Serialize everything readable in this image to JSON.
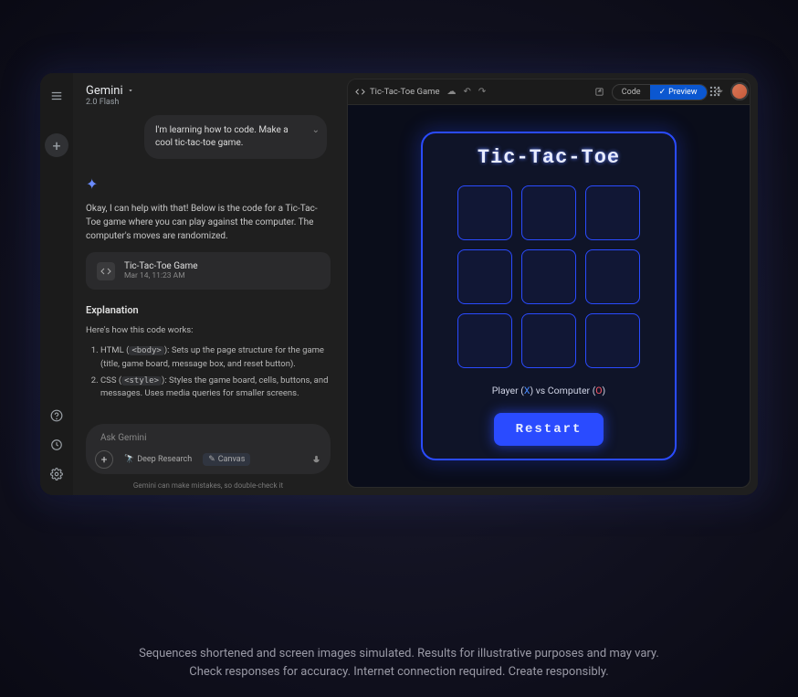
{
  "header": {
    "app_name": "Gemini",
    "model": "2.0 Flash"
  },
  "conversation": {
    "user_prompt": "I'm learning how to code. Make a cool tic-tac-toe game.",
    "assistant_intro": "Okay, I can help with that! Below is the code for a Tic-Tac-Toe game where you can play against the computer. The computer's moves are randomized.",
    "artifact": {
      "title": "Tic-Tac-Toe Game",
      "timestamp": "Mar 14, 11:23 AM"
    },
    "explanation_title": "Explanation",
    "explanation_intro": "Here's how this code works:",
    "explanation_items": [
      {
        "prefix": "HTML (",
        "code": "<body>",
        "suffix": "): Sets up the page structure for the game (title, game board, message box, and reset button)."
      },
      {
        "prefix": "CSS (",
        "code": "<style>",
        "suffix": "): Styles the game board, cells, buttons, and messages. Uses media queries for smaller screens."
      }
    ]
  },
  "composer": {
    "placeholder": "Ask Gemini",
    "chip_deep_research": "Deep Research",
    "chip_canvas": "Canvas"
  },
  "disclaimer_line": "Gemini can make mistakes, so double-check it",
  "preview_panel": {
    "title": "Tic-Tac-Toe Game",
    "toggle_code": "Code",
    "toggle_preview": "Preview"
  },
  "game": {
    "title": "Tic-Tac-Toe",
    "status_prefix": "Player (",
    "status_mid": ") vs Computer (",
    "status_suffix": ")",
    "player_x": "X",
    "player_o": "O",
    "restart_label": "Restart"
  },
  "footer": {
    "line1": "Sequences shortened and screen images simulated. Results for illustrative purposes and may vary.",
    "line2": "Check responses for accuracy. Internet connection required. Create responsibly."
  }
}
